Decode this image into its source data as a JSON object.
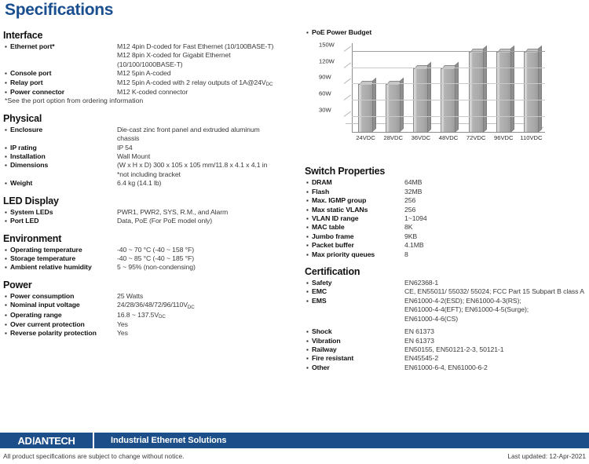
{
  "title": "Specifications",
  "left_sections": [
    {
      "title": "Interface",
      "rows": [
        {
          "label": "Ethernet port*",
          "values": [
            "M12 4pin D-coded for Fast Ethernet (10/100BASE-T)",
            "M12 8pin X-coded for Gigabit Ethernet",
            "(10/100/1000BASE-T)"
          ]
        },
        {
          "label": "Console port",
          "values": [
            "M12 5pin A-coded"
          ]
        },
        {
          "label": "Relay port",
          "values": [
            "M12 5pin A-coded with 2 relay outputs of 1A@24V"
          ],
          "sub": "DC"
        },
        {
          "label": "Power connector",
          "values": [
            "M12 K-coded connector"
          ]
        }
      ],
      "note": "*See the port option from ordering information"
    },
    {
      "title": "Physical",
      "rows": [
        {
          "label": "Enclosure",
          "values": [
            "Die-cast zinc front panel and extruded aluminum",
            "chassis"
          ]
        },
        {
          "label": "IP rating",
          "values": [
            "IP 54"
          ]
        },
        {
          "label": "Installation",
          "values": [
            "Wall Mount"
          ]
        },
        {
          "label": "Dimensions",
          "values": [
            "(W x H x D) 300 x 105 x 105 mm/11.8 x 4.1 x 4.1 in",
            "*not including bracket"
          ]
        },
        {
          "label": "Weight",
          "values": [
            "6.4 kg (14.1 lb)"
          ]
        }
      ]
    },
    {
      "title": "LED Display",
      "rows": [
        {
          "label": "System LEDs",
          "values": [
            "PWR1, PWR2, SYS, R.M., and Alarm"
          ]
        },
        {
          "label": "Port LED",
          "values": [
            "Data, PoE (For PoE model only)"
          ]
        }
      ]
    },
    {
      "title": "Environment",
      "rows": [
        {
          "label": "Operating temperature",
          "values": [
            "-40 ~ 70 °C (-40 ~ 158 °F)"
          ]
        },
        {
          "label": "Storage temperature",
          "values": [
            "-40 ~ 85 °C (-40 ~ 185 °F)"
          ]
        },
        {
          "label": "Ambient relative humidity",
          "values": [
            "5 ~ 95% (non-condensing)"
          ]
        }
      ]
    },
    {
      "title": "Power",
      "rows": [
        {
          "label": "Power consumption",
          "values": [
            "25 Watts"
          ]
        },
        {
          "label": "Nominal input voltage",
          "values": [
            "24/28/36/48/72/96/110V"
          ],
          "sub": "DC"
        },
        {
          "label": "Operating range",
          "values": [
            "16.8 ~ 137.5V"
          ],
          "sub": "DC"
        },
        {
          "label": "Over current protection",
          "values": [
            "Yes"
          ]
        },
        {
          "label": "Reverse polarity protection",
          "values": [
            "Yes"
          ]
        }
      ]
    }
  ],
  "chart_header_label": "PoE Power Budget",
  "chart_data": {
    "type": "bar",
    "title": "PoE Power Budget",
    "categories": [
      "24VDC",
      "28VDC",
      "36VDC",
      "48VDC",
      "72VDC",
      "96VDC",
      "110VDC"
    ],
    "values": [
      90,
      90,
      120,
      120,
      150,
      150,
      150
    ],
    "ytick_labels": [
      "150W",
      "120W",
      "90W",
      "60W",
      "30W"
    ],
    "yticks": [
      150,
      120,
      90,
      60,
      30
    ],
    "ylim": [
      0,
      165
    ],
    "xlabel": "",
    "ylabel": "",
    "grid": true,
    "legend": "none"
  },
  "right_sections": [
    {
      "title": "Switch Properties",
      "rows": [
        {
          "label": "DRAM",
          "values": [
            "64MB"
          ]
        },
        {
          "label": "Flash",
          "values": [
            "32MB"
          ]
        },
        {
          "label": "Max. IGMP group",
          "values": [
            "256"
          ]
        },
        {
          "label": "Max static VLANs",
          "values": [
            "256"
          ]
        },
        {
          "label": "VLAN ID range",
          "values": [
            "1~1094"
          ]
        },
        {
          "label": "MAC table",
          "values": [
            "8K"
          ]
        },
        {
          "label": "Jumbo frame",
          "values": [
            "9KB"
          ]
        },
        {
          "label": "Packet buffer",
          "values": [
            "4.1MB"
          ]
        },
        {
          "label": "Max priority queues",
          "values": [
            "8"
          ]
        }
      ]
    },
    {
      "title": "Certification",
      "rows": [
        {
          "label": "Safety",
          "values": [
            "EN62368-1"
          ]
        },
        {
          "label": "EMC",
          "values": [
            "CE, EN55011/ 55032/ 55024; FCC Part 15 Subpart B class A"
          ]
        },
        {
          "label": "EMS",
          "values": [
            "EN61000-4-2(ESD); EN61000-4-3(RS);",
            "EN61000-4-4(EFT); EN61000-4-5(Surge);",
            "EN61000-4-6(CS)"
          ]
        },
        {
          "label": "Shock",
          "values": [
            "EN 61373"
          ],
          "gap_before": true
        },
        {
          "label": "Vibration",
          "values": [
            "EN 61373"
          ]
        },
        {
          "label": "Railway",
          "values": [
            "EN50155, EN50121-2-3, 50121-1"
          ]
        },
        {
          "label": "Fire resistant",
          "values": [
            "EN45545-2"
          ]
        },
        {
          "label": "Other",
          "values": [
            "EN61000-6-4, EN61000-6-2"
          ]
        }
      ]
    }
  ],
  "footer": {
    "logo_part1": "AD",
    "logo_slash": "\\",
    "logo_part2": "ANTECH",
    "tagline": "Industrial Ethernet Solutions",
    "note": "All product specifications are subject to change without notice.",
    "updated": "Last updated: 12-Apr-2021"
  },
  "colors": {
    "brand_blue": "#1c4f8a",
    "title_blue": "#1a4f8f",
    "bar_gray": "#b4b4b4"
  }
}
